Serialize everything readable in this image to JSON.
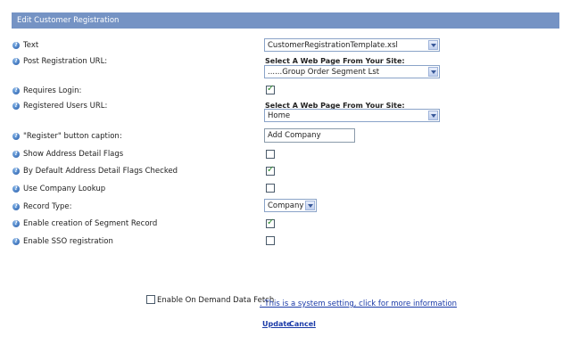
{
  "header": {
    "title": "Edit Customer Registration"
  },
  "fields": [
    {
      "label": "Text"
    },
    {
      "label": "Post Registration URL:"
    },
    {
      "label": "Requires Login:"
    },
    {
      "label": "Registered Users URL:"
    },
    {
      "label": "\"Register\" button caption:"
    },
    {
      "label": "Show Address Detail Flags"
    },
    {
      "label": "By Default Address Detail Flags Checked"
    },
    {
      "label": "Use Company Lookup"
    },
    {
      "label": "Record Type:"
    },
    {
      "label": "Enable creation of Segment Record"
    },
    {
      "label": "Enable SSO registration"
    }
  ],
  "controls": {
    "text_select": "CustomerRegistrationTemplate.xsl",
    "post_url_caption": "Select A Web Page From Your Site:",
    "post_url_select": "......Group Order Segment Lst",
    "registered_url_caption": "Select A Web Page From Your Site:",
    "registered_url_select": "Home",
    "register_caption_value": "Add Company",
    "record_type_select": "Company",
    "requires_login": true,
    "show_address_flags": false,
    "default_address_flags_checked": true,
    "use_company_lookup": false,
    "enable_segment_record": true,
    "enable_sso": false
  },
  "footer": {
    "on_demand_label": "Enable On Demand Data Fetch",
    "on_demand_checked": false,
    "system_setting_link": ". This is a system setting, click for more information",
    "update_label": "Update",
    "cancel_label": "Cancel"
  }
}
